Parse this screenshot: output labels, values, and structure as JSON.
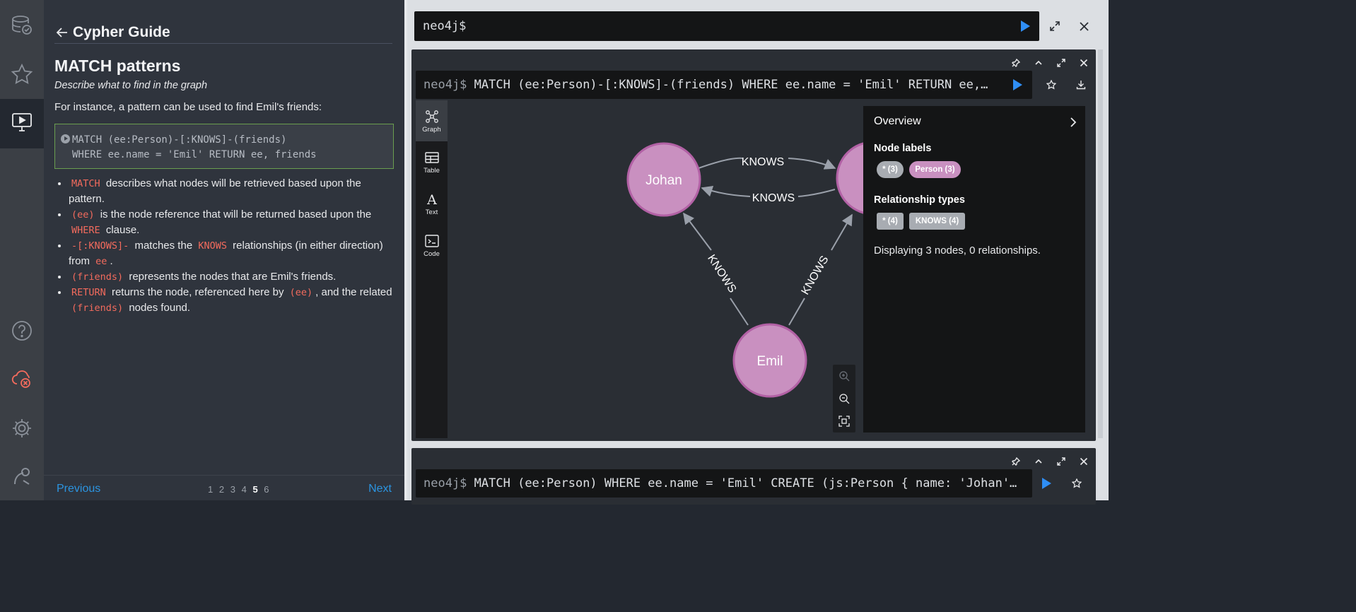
{
  "sidebar_icons": [
    {
      "name": "database-icon"
    },
    {
      "name": "favorites-star-icon"
    },
    {
      "name": "guides-monitor-icon"
    },
    {
      "name": "help-icon"
    },
    {
      "name": "cloud-disconnected-icon"
    },
    {
      "name": "settings-gear-icon"
    },
    {
      "name": "about-icon"
    }
  ],
  "guide": {
    "title": "Cypher Guide",
    "section_title": "MATCH patterns",
    "section_subtitle": "Describe what to find in the graph",
    "intro": "For instance, a pattern can be used to find Emil's friends:",
    "code_line1": "MATCH (ee:Person)-[:KNOWS]-(friends)",
    "code_line2": "WHERE ee.name = 'Emil' RETURN ee, friends",
    "bullets": [
      {
        "kw": "MATCH",
        "text": "describes what nodes will be retrieved based upon the pattern."
      },
      {
        "kw": "(ee)",
        "text": "is the node reference that will be returned based upon the",
        "kw2": "WHERE",
        "text2": "clause."
      },
      {
        "kw": "-[:KNOWS]-",
        "text": "matches the",
        "kw2": "KNOWS",
        "text2": "relationships (in either direction) from",
        "kw3": "ee",
        "text3": "."
      },
      {
        "kw": "(friends)",
        "text": "represents the nodes that are Emil's friends."
      },
      {
        "kw": "RETURN",
        "text": "returns the node, referenced here by",
        "kw2": "(ee)",
        "text2": ", and the related",
        "kw3": "(friends)",
        "text3": "nodes found."
      }
    ],
    "prev_label": "Previous",
    "next_label": "Next",
    "pages": [
      "1",
      "2",
      "3",
      "4",
      "5",
      "6"
    ],
    "current_page": "5"
  },
  "editor": {
    "prompt": "neo4j$",
    "value": ""
  },
  "frame1": {
    "prompt": "neo4j$",
    "query": "MATCH (ee:Person)-[:KNOWS]-(friends) WHERE ee.name = 'Emil' RETURN ee,…",
    "tabs": [
      "Graph",
      "Table",
      "Text",
      "Code"
    ],
    "active_tab": "Graph",
    "graph": {
      "nodes": [
        {
          "label": "Johan"
        },
        {
          "label": "Emil"
        },
        {
          "label": ""
        }
      ],
      "edges": [
        {
          "label": "KNOWS"
        },
        {
          "label": "KNOWS"
        },
        {
          "label": "KNOWS"
        },
        {
          "label": "KNOWS"
        }
      ],
      "node_color": "#c990c0",
      "node_border": "#b261a5"
    },
    "overview": {
      "title": "Overview",
      "node_labels_heading": "Node labels",
      "node_label_pills": [
        "* (3)",
        "Person (3)"
      ],
      "rel_types_heading": "Relationship types",
      "rel_type_tags": [
        "* (4)",
        "KNOWS (4)"
      ],
      "status": "Displaying 3 nodes, 0 relationships."
    }
  },
  "frame2": {
    "prompt": "neo4j$",
    "query": "MATCH (ee:Person) WHERE ee.name = 'Emil' CREATE (js:Person { name: 'Johan'…"
  },
  "colors": {
    "accent_blue": "#2f8ef5",
    "keyword_red": "#f36b5d",
    "guide_bg": "#2f343d",
    "code_border": "#6a9e4f"
  }
}
